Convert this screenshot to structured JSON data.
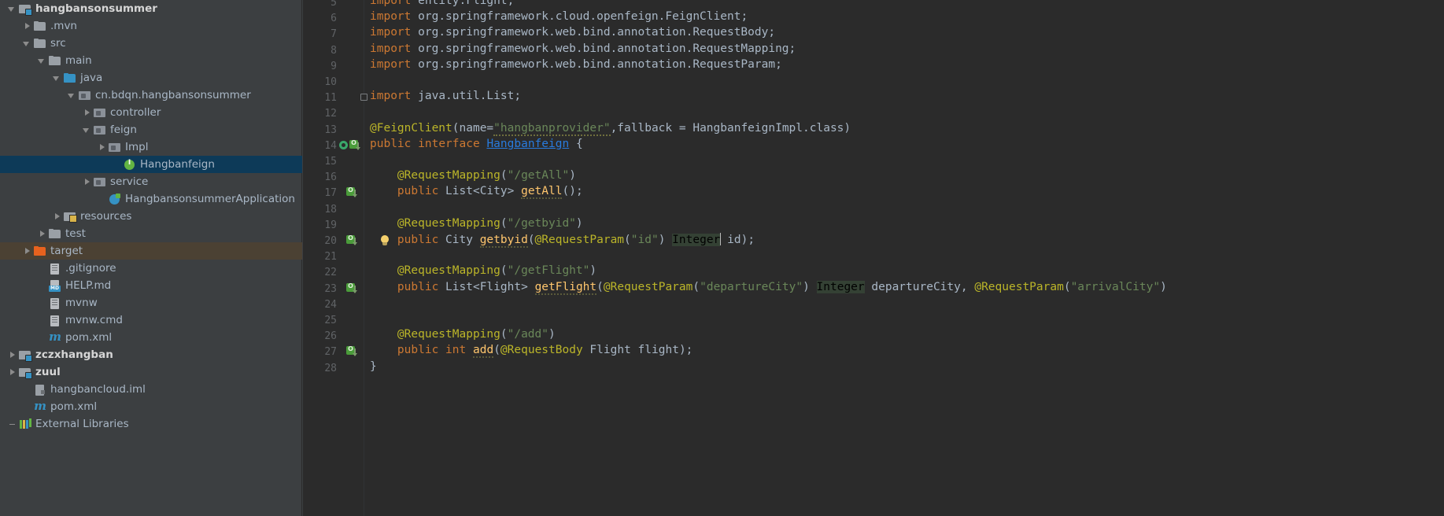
{
  "project_tree": {
    "items": [
      {
        "label": "hangbansonsummer",
        "indent": 0,
        "arrow": "down",
        "icon": "module-folder-icon",
        "bold": true,
        "state": "normal"
      },
      {
        "label": ".mvn",
        "indent": 1,
        "arrow": "right",
        "icon": "folder-icon",
        "bold": false,
        "state": "normal"
      },
      {
        "label": "src",
        "indent": 1,
        "arrow": "down",
        "icon": "folder-icon",
        "bold": false,
        "state": "normal"
      },
      {
        "label": "main",
        "indent": 2,
        "arrow": "down",
        "icon": "folder-icon",
        "bold": false,
        "state": "normal"
      },
      {
        "label": "java",
        "indent": 3,
        "arrow": "down",
        "icon": "source-root-folder-icon",
        "bold": false,
        "state": "normal"
      },
      {
        "label": "cn.bdqn.hangbansonsummer",
        "indent": 4,
        "arrow": "down",
        "icon": "package-icon",
        "bold": false,
        "state": "normal"
      },
      {
        "label": "controller",
        "indent": 5,
        "arrow": "right",
        "icon": "package-icon",
        "bold": false,
        "state": "normal"
      },
      {
        "label": "feign",
        "indent": 5,
        "arrow": "down",
        "icon": "package-icon",
        "bold": false,
        "state": "normal"
      },
      {
        "label": "Impl",
        "indent": 6,
        "arrow": "right",
        "icon": "package-icon",
        "bold": false,
        "state": "normal"
      },
      {
        "label": "Hangbanfeign",
        "indent": 7,
        "arrow": "none",
        "icon": "interface-icon",
        "bold": false,
        "state": "selected"
      },
      {
        "label": "service",
        "indent": 5,
        "arrow": "right",
        "icon": "package-icon",
        "bold": false,
        "state": "normal"
      },
      {
        "label": "HangbansonsummerApplication",
        "indent": 6,
        "arrow": "none",
        "icon": "spring-boot-app-icon",
        "bold": false,
        "state": "normal"
      },
      {
        "label": "resources",
        "indent": 3,
        "arrow": "right",
        "icon": "resources-folder-icon",
        "bold": false,
        "state": "normal"
      },
      {
        "label": "test",
        "indent": 2,
        "arrow": "right",
        "icon": "folder-icon",
        "bold": false,
        "state": "normal"
      },
      {
        "label": "target",
        "indent": 1,
        "arrow": "right",
        "icon": "excluded-folder-icon",
        "bold": false,
        "state": "hover"
      },
      {
        "label": ".gitignore",
        "indent": 2,
        "arrow": "none",
        "icon": "file-icon",
        "bold": false,
        "state": "normal"
      },
      {
        "label": "HELP.md",
        "indent": 2,
        "arrow": "none",
        "icon": "markdown-file-icon",
        "bold": false,
        "state": "normal"
      },
      {
        "label": "mvnw",
        "indent": 2,
        "arrow": "none",
        "icon": "file-icon",
        "bold": false,
        "state": "normal"
      },
      {
        "label": "mvnw.cmd",
        "indent": 2,
        "arrow": "none",
        "icon": "file-icon",
        "bold": false,
        "state": "normal"
      },
      {
        "label": "pom.xml",
        "indent": 2,
        "arrow": "none",
        "icon": "maven-file-icon",
        "bold": false,
        "state": "normal"
      },
      {
        "label": "zczxhangban",
        "indent": 0,
        "arrow": "right",
        "icon": "module-folder-icon",
        "bold": true,
        "state": "normal"
      },
      {
        "label": "zuul",
        "indent": 0,
        "arrow": "right",
        "icon": "module-folder-icon",
        "bold": true,
        "state": "normal"
      },
      {
        "label": "hangbancloud.iml",
        "indent": 1,
        "arrow": "none",
        "icon": "iml-file-icon",
        "bold": false,
        "state": "normal"
      },
      {
        "label": "pom.xml",
        "indent": 1,
        "arrow": "none",
        "icon": "maven-file-icon",
        "bold": false,
        "state": "normal"
      },
      {
        "label": "External Libraries",
        "indent": 0,
        "arrow": "dash",
        "icon": "libraries-icon",
        "bold": false,
        "state": "normal"
      }
    ]
  },
  "editor": {
    "first_visible_line": 5,
    "last_visible_line": 28,
    "caret_line": 20,
    "caret_after_token": "Integer",
    "gutter": {
      "line_14_markers": [
        "spring-bean-icon",
        "implemented-method-icon"
      ],
      "line_17_markers": [
        "implemented-method-icon"
      ],
      "line_20_markers": [
        "implemented-method-icon"
      ],
      "line_23_markers": [
        "implemented-method-icon"
      ],
      "line_27_markers": [
        "implemented-method-icon"
      ],
      "line_20_intention": "lightbulb-icon"
    },
    "lines": [
      {
        "n": 5,
        "text": "import entity.Flight;"
      },
      {
        "n": 6,
        "text": "import org.springframework.cloud.openfeign.FeignClient;"
      },
      {
        "n": 7,
        "text": "import org.springframework.web.bind.annotation.RequestBody;"
      },
      {
        "n": 8,
        "text": "import org.springframework.web.bind.annotation.RequestMapping;"
      },
      {
        "n": 9,
        "text": "import org.springframework.web.bind.annotation.RequestParam;"
      },
      {
        "n": 10,
        "text": ""
      },
      {
        "n": 11,
        "text": "import java.util.List;"
      },
      {
        "n": 12,
        "text": ""
      },
      {
        "n": 13,
        "text": "@FeignClient(name=\"hangbanprovider\",fallback = HangbanfeignImpl.class)"
      },
      {
        "n": 14,
        "text": "public interface Hangbanfeign {"
      },
      {
        "n": 15,
        "text": ""
      },
      {
        "n": 16,
        "text": "    @RequestMapping(\"/getAll\")"
      },
      {
        "n": 17,
        "text": "    public List<City> getAll();"
      },
      {
        "n": 18,
        "text": ""
      },
      {
        "n": 19,
        "text": "    @RequestMapping(\"/getbyid\")"
      },
      {
        "n": 20,
        "text": "    public City getbyid(@RequestParam(\"id\") Integer id);"
      },
      {
        "n": 21,
        "text": ""
      },
      {
        "n": 22,
        "text": "    @RequestMapping(\"/getFlight\")"
      },
      {
        "n": 23,
        "text": "    public List<Flight> getFlight(@RequestParam(\"departureCity\") Integer departureCity, @RequestParam(\"arrivalCity\")"
      },
      {
        "n": 24,
        "text": ""
      },
      {
        "n": 25,
        "text": ""
      },
      {
        "n": 26,
        "text": "    @RequestMapping(\"/add\")"
      },
      {
        "n": 27,
        "text": "    public int add(@RequestBody Flight flight);"
      },
      {
        "n": 28,
        "text": "}"
      }
    ]
  },
  "colors": {
    "tree_background": "#3c3f41",
    "editor_background": "#2b2b2b",
    "selection_blue": "#0d3a58",
    "hover_brown": "#4b4133",
    "keyword_orange": "#cc7832",
    "annotation_yellow": "#bbb529",
    "string_green": "#6a8759",
    "plain_text": "#a9b7c6",
    "method_yellow": "#ffc66d",
    "interface_link_blue": "#287bde",
    "line_number_gray": "#606366"
  }
}
